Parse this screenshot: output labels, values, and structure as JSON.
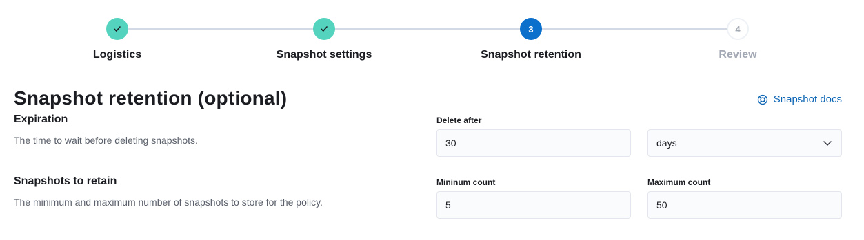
{
  "steps": [
    {
      "number": "1",
      "title": "Logistics",
      "status": "complete"
    },
    {
      "number": "2",
      "title": "Snapshot settings",
      "status": "complete"
    },
    {
      "number": "3",
      "title": "Snapshot retention",
      "status": "current"
    },
    {
      "number": "4",
      "title": "Review",
      "status": "incomplete"
    }
  ],
  "page": {
    "title": "Snapshot retention (optional)",
    "docs_link": "Snapshot docs"
  },
  "expiration": {
    "title": "Expiration",
    "description": "The time to wait before deleting snapshots.",
    "delete_after_label": "Delete after",
    "delete_after_value": "30",
    "unit_selected": "days"
  },
  "retain": {
    "title": "Snapshots to retain",
    "description": "The minimum and maximum number of snapshots to store for the policy.",
    "min_label": "Mininum count",
    "min_value": "5",
    "max_label": "Maximum count",
    "max_value": "50"
  },
  "colors": {
    "complete": "#54d4bf",
    "current": "#0b6fcc",
    "link": "#0b64b4"
  }
}
